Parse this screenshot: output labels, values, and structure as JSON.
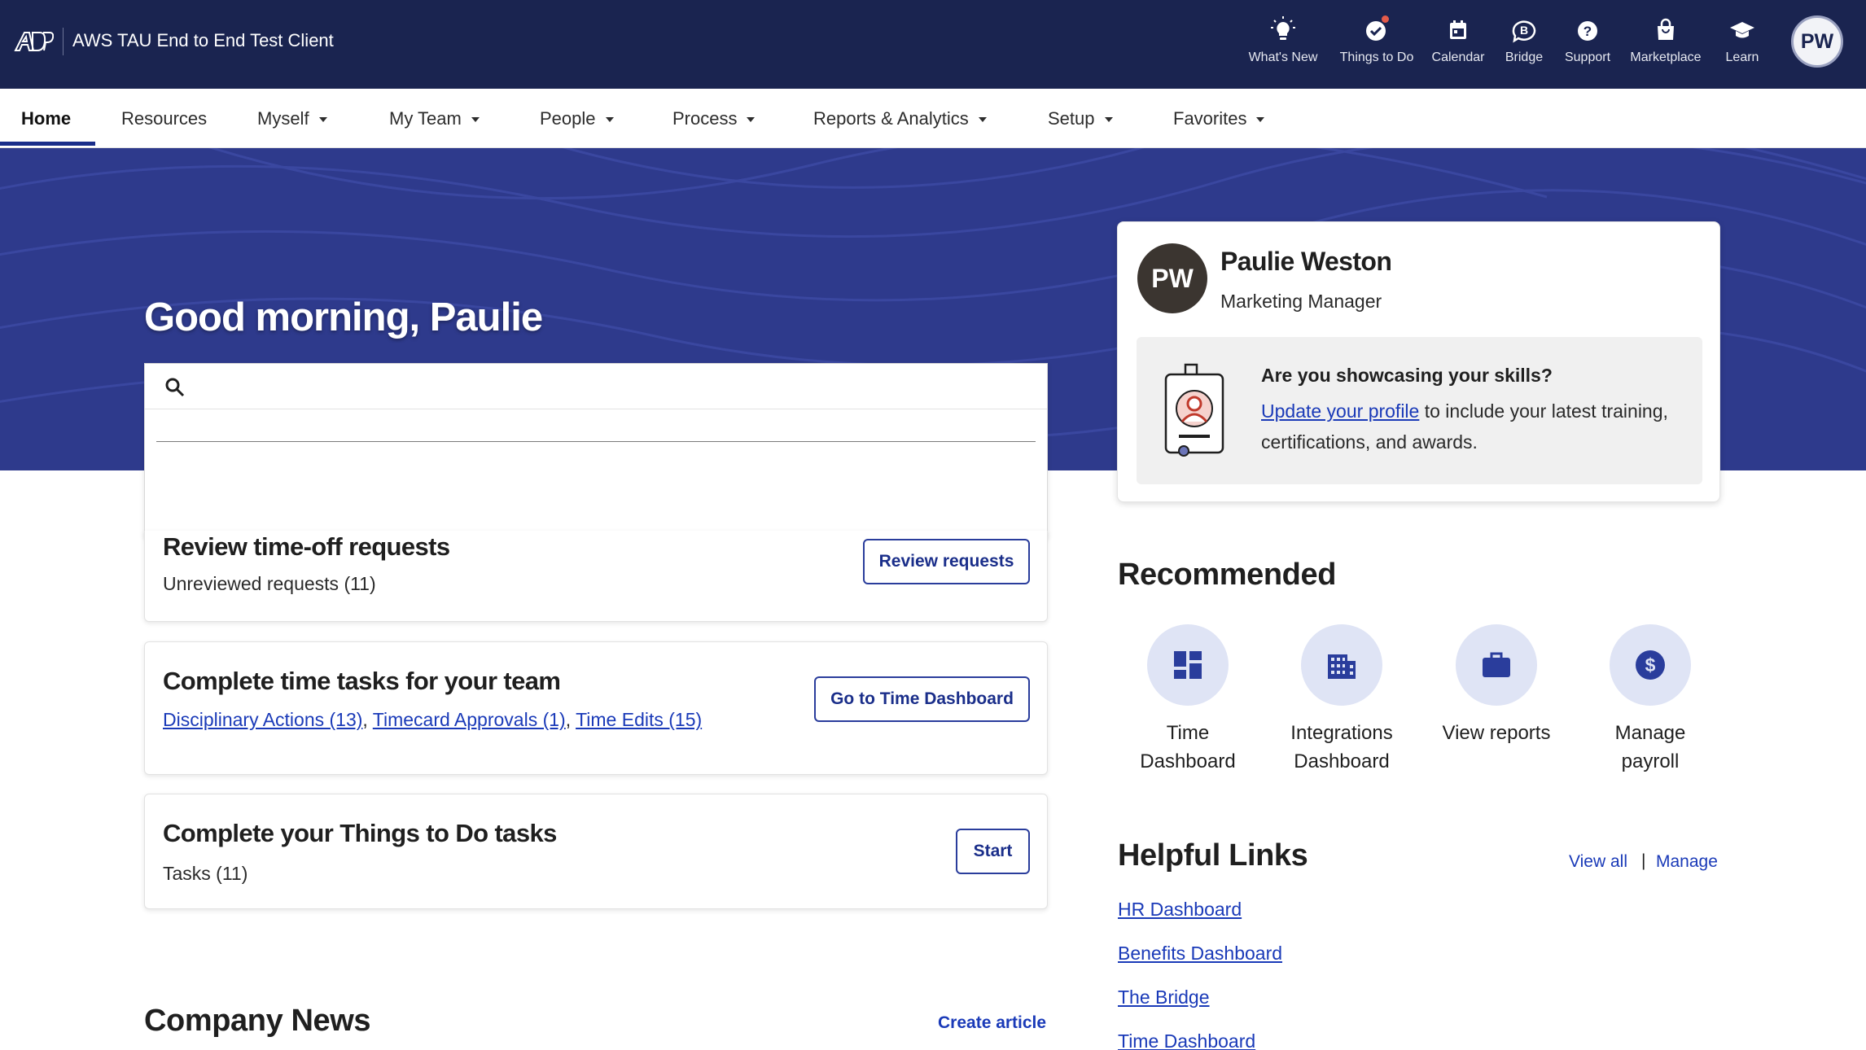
{
  "app": {
    "client_name": "AWS TAU End to End Test Client",
    "user_initials": "PW"
  },
  "top_icons": [
    {
      "label": "What's New",
      "icon": "lightbulb-icon"
    },
    {
      "label": "Things to Do",
      "icon": "check-circle-icon"
    },
    {
      "label": "Calendar",
      "icon": "calendar-icon"
    },
    {
      "label": "Bridge",
      "icon": "bridge-icon"
    },
    {
      "label": "Support",
      "icon": "help-icon"
    },
    {
      "label": "Marketplace",
      "icon": "shopping-bag-icon"
    },
    {
      "label": "Learn",
      "icon": "graduation-cap-icon"
    }
  ],
  "nav": {
    "items": [
      {
        "label": "Home"
      },
      {
        "label": "Resources"
      },
      {
        "label": "Myself"
      },
      {
        "label": "My Team"
      },
      {
        "label": "People"
      },
      {
        "label": "Process"
      },
      {
        "label": "Reports & Analytics"
      },
      {
        "label": "Setup"
      },
      {
        "label": "Favorites"
      }
    ]
  },
  "hero": {
    "greeting": "Good morning, Paulie"
  },
  "search": {
    "value": "",
    "placeholder": ""
  },
  "tasks": [
    {
      "title": "Review time-off requests",
      "subtitle": "Unreviewed requests (11)",
      "button": "Review requests"
    },
    {
      "title": "Complete time tasks for your team",
      "links": [
        "Disciplinary Actions (13)",
        "Timecard Approvals (1)",
        "Time Edits (15)"
      ],
      "button": "Go to Time Dashboard"
    },
    {
      "title": "Complete your Things to Do tasks",
      "subtitle": "Tasks (11)",
      "button": "Start"
    }
  ],
  "company_news": {
    "title": "Company News",
    "create_label": "Create article"
  },
  "profile": {
    "initials": "PW",
    "name": "Paulie Weston",
    "role": "Marketing Manager",
    "showcase_title": "Are you showcasing your skills?",
    "showcase_link": "Update your profile",
    "showcase_text": " to include your latest training, certifications, and awards."
  },
  "recommended": {
    "title": "Recommended",
    "items": [
      {
        "label": "Time Dashboard",
        "icon": "dashboard-icon"
      },
      {
        "label": "Integrations Dashboard",
        "icon": "building-icon"
      },
      {
        "label": "View reports",
        "icon": "briefcase-icon"
      },
      {
        "label": "Manage payroll",
        "icon": "dollar-icon"
      }
    ]
  },
  "helpful_links": {
    "title": "Helpful Links",
    "view_all": "View all",
    "separator": "|",
    "manage": "Manage",
    "links": [
      "HR Dashboard",
      "Benefits Dashboard",
      "The Bridge",
      "Time Dashboard"
    ]
  },
  "colors": {
    "topbar": "#1a2450",
    "hero": "#2e3a8c",
    "link": "#1a3ab8",
    "button_border": "#2a3d9c"
  }
}
